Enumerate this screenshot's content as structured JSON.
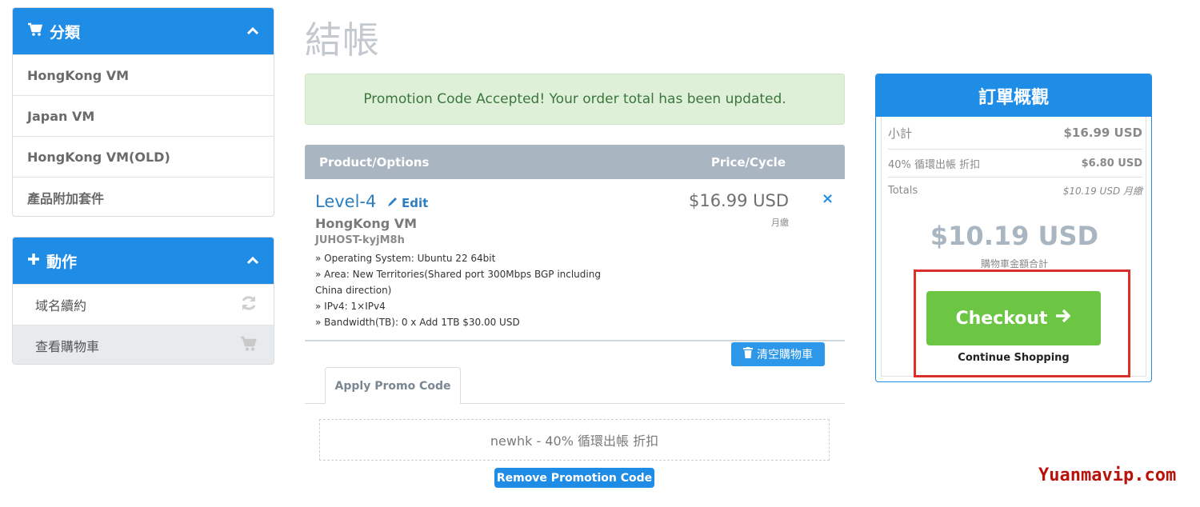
{
  "sidebar": {
    "categories": {
      "title": "分類",
      "items": [
        "HongKong VM",
        "Japan VM",
        "HongKong VM(OLD)",
        "產品附加套件"
      ]
    },
    "actions": {
      "title": "動作",
      "items": [
        {
          "label": "域名續約",
          "icon": "refresh-icon"
        },
        {
          "label": "查看購物車",
          "icon": "cart-icon"
        }
      ]
    }
  },
  "page": {
    "title": "結帳"
  },
  "alert": {
    "text": "Promotion Code Accepted! Your order total has been updated."
  },
  "table": {
    "col_product": "Product/Options",
    "col_price": "Price/Cycle"
  },
  "item": {
    "name": "Level-4",
    "edit_label": "Edit",
    "group": "HongKong VM",
    "domain": "JUHOST-kyjM8h",
    "options": [
      "» Operating System: Ubuntu 22 64bit",
      "» Area: New Territories(Shared port 300Mbps BGP including China direction)",
      "» IPv4: 1×IPv4",
      "» Bandwidth(TB): 0 x Add 1TB $30.00 USD"
    ],
    "price": "$16.99 USD",
    "cycle": "月繳",
    "remove_symbol": "×"
  },
  "empty_cart_label": "清空購物車",
  "promo": {
    "tab_label": "Apply Promo Code",
    "applied": "newhk - 40% 循環出帳 折扣",
    "remove_label": "Remove Promotion Code"
  },
  "summary": {
    "title": "訂單概觀",
    "subtotal_label": "小計",
    "subtotal_value": "$16.99 USD",
    "discount_label": "40% 循環出帳 折扣",
    "discount_value": "$6.80 USD",
    "totals_label": "Totals",
    "totals_value": "$10.19 USD 月繳",
    "total_amount": "$10.19 USD",
    "total_caption": "購物車金額合計",
    "checkout_label": "Checkout",
    "continue_label": "Continue Shopping"
  },
  "watermark": "Yuanmavip.com",
  "colors": {
    "primary": "#1f8ce6",
    "success": "#6cc644",
    "alert_bg": "#dff0d8",
    "highlight": "#d9302c"
  }
}
